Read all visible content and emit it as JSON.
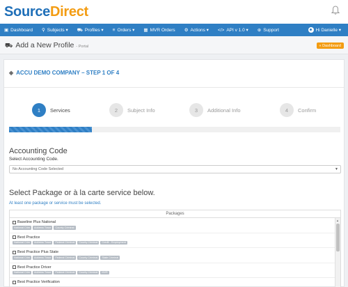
{
  "brand": {
    "part1": "Source",
    "part2": "Direct"
  },
  "nav": {
    "items": [
      {
        "icon": "dashboard-icon",
        "glyph": "▣",
        "label": "Dashboard"
      },
      {
        "icon": "search-icon",
        "glyph": "⚲",
        "label": "Subjects ▾"
      },
      {
        "icon": "cart-icon",
        "glyph": "⛟",
        "label": "Profiles ▾"
      },
      {
        "icon": "list-icon",
        "glyph": "≡",
        "label": "Orders ▾"
      },
      {
        "icon": "table-icon",
        "glyph": "▦",
        "label": "MVR Orders"
      },
      {
        "icon": "gear-icon",
        "glyph": "⚙",
        "label": "Actions ▾"
      },
      {
        "icon": "code-icon",
        "glyph": "</>",
        "label": "API v 1.0 ▾"
      },
      {
        "icon": "plus-circle-icon",
        "glyph": "⊕",
        "label": "Support"
      }
    ],
    "user": "Hi Danielle ▾"
  },
  "page": {
    "title": "Add a New Profile",
    "subtitle": "- Portal",
    "dashboard_button": "« Dashboard"
  },
  "card": {
    "title": "ACCU DEMO COMPANY – STEP 1 OF 4"
  },
  "steps": [
    {
      "num": "1",
      "label": "Services",
      "active": true
    },
    {
      "num": "2",
      "label": "Subject Info",
      "active": false
    },
    {
      "num": "3",
      "label": "Additional Info",
      "active": false
    },
    {
      "num": "4",
      "label": "Confirm",
      "active": false
    }
  ],
  "progress": {
    "percent": 25
  },
  "accounting": {
    "heading": "Accounting Code",
    "label": "Select Accounting Code.",
    "selected": "No Accounting Code Selected"
  },
  "packages_section": {
    "heading": "Select Package or à la carte service below.",
    "note": "At least one package or service must be selected.",
    "panel_title": "Packages",
    "items": [
      {
        "name": "Baseline Plus National",
        "tags": [
          "National Crim",
          "Address Trace",
          "County Criminal"
        ]
      },
      {
        "name": "Best Practice",
        "tags": [
          "National Crim",
          "Address Trace",
          "Federal Criminal",
          "County Criminal",
          "Credit - Employment"
        ]
      },
      {
        "name": "Best Practice Plus State",
        "tags": [
          "National Crim",
          "Address Trace",
          "Federal Criminal",
          "County Criminal",
          "State Criminal"
        ]
      },
      {
        "name": "Best Practice Driver",
        "tags": [
          "National Crim",
          "Address Trace",
          "Federal Criminal",
          "County Criminal",
          "MVR"
        ]
      },
      {
        "name": "Best Practice Verification",
        "tags": []
      }
    ]
  },
  "colors": {
    "brand_blue": "#2f7fc4",
    "brand_orange": "#f39c12"
  }
}
